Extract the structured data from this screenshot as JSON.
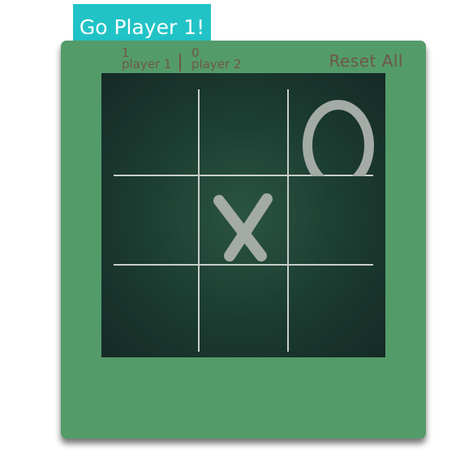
{
  "turn_banner": "Go Player 1!",
  "scoreboard": {
    "player1": {
      "score": "1",
      "label": "player 1"
    },
    "player2": {
      "score": "0",
      "label": "player 2"
    }
  },
  "reset_label": "Reset All",
  "board": {
    "cells": [
      "",
      "",
      "O",
      "",
      "X",
      "",
      "",
      "",
      ""
    ]
  },
  "colors": {
    "banner": "#21c3c6",
    "frame": "#549b6a",
    "board": "#1b3b30",
    "marks": "#a4aba6",
    "grid": "#c8cec9",
    "text": "#6f5748"
  }
}
